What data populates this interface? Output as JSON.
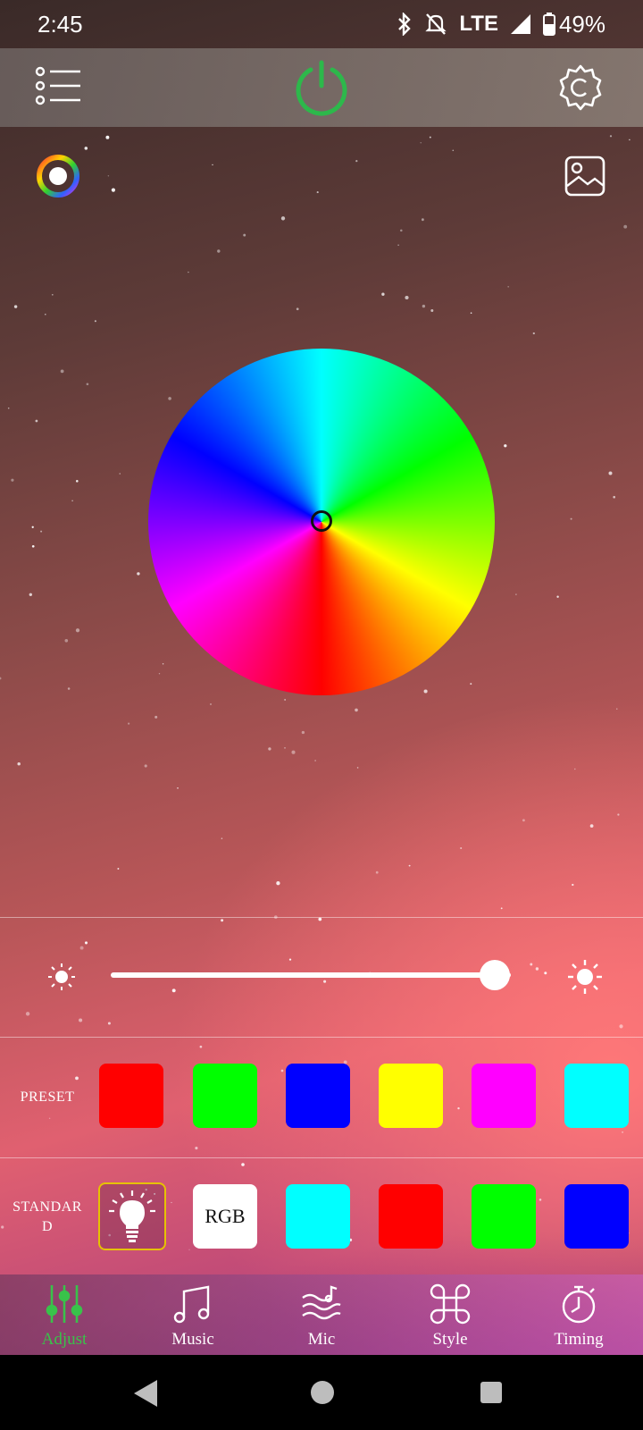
{
  "status_bar": {
    "time": "2:45",
    "network": "LTE",
    "battery": "49%"
  },
  "colors": {
    "power_on": "#2db84b",
    "active_tab": "#39c24a",
    "bulb_border": "#e6c200"
  },
  "brightness": {
    "level": 0.96
  },
  "preset": {
    "label": "PRESET",
    "swatches": [
      "#ff0000",
      "#00ff00",
      "#0000ff",
      "#ffff00",
      "#ff00ff",
      "#00ffff"
    ]
  },
  "standard": {
    "label": "STANDAR D",
    "label_line1": "STANDAR",
    "label_line2": "D",
    "bulb_icon": "lightbulb-icon",
    "rgb_label": "RGB",
    "swatches": [
      "#00ffff",
      "#ff0000",
      "#00ff00",
      "#0000ff"
    ]
  },
  "bottom_nav": [
    {
      "label": "Adjust",
      "icon": "sliders-icon",
      "active": true
    },
    {
      "label": "Music",
      "icon": "music-note-icon",
      "active": false
    },
    {
      "label": "Mic",
      "icon": "mic-wave-icon",
      "active": false
    },
    {
      "label": "Style",
      "icon": "command-icon",
      "active": false
    },
    {
      "label": "Timing",
      "icon": "stopwatch-icon",
      "active": false
    }
  ]
}
